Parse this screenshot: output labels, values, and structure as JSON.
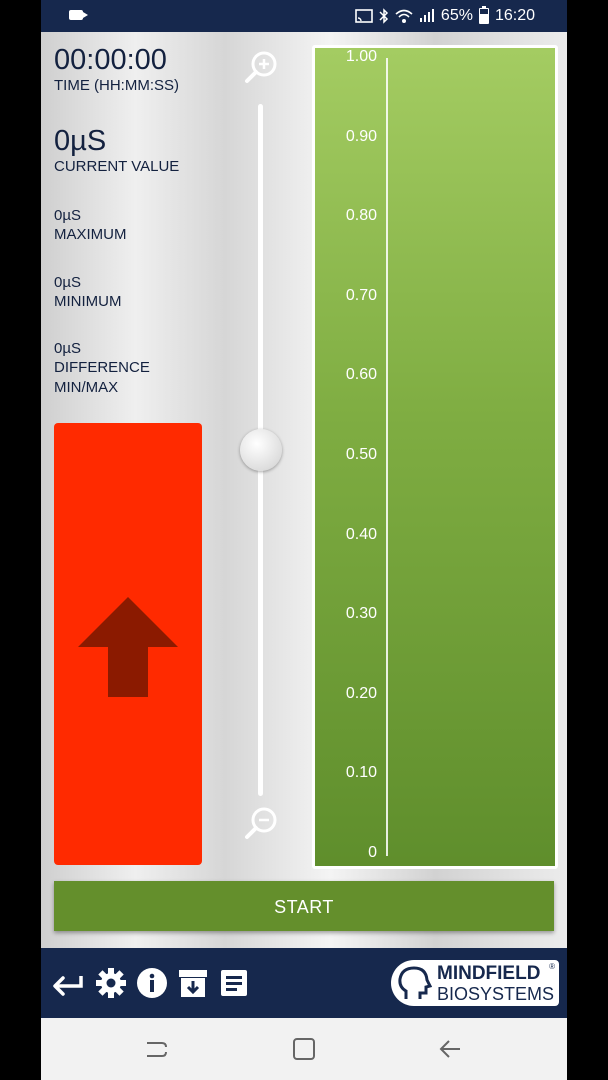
{
  "status_bar": {
    "battery_percent": "65%",
    "time": "16:20",
    "battery_level": 0.65,
    "icons": [
      "video-icon",
      "cast-icon",
      "bluetooth-icon",
      "wifi-icon",
      "signal-icon",
      "battery-icon"
    ]
  },
  "stats": {
    "time_value": "00:00:00",
    "time_label": "TIME (HH:MM:SS)",
    "current_value": "0µS",
    "current_label": "CURRENT VALUE",
    "maximum_value": "0µS",
    "maximum_label": "MAXIMUM",
    "minimum_value": "0µS",
    "minimum_label": "MINIMUM",
    "difference_value": "0µS",
    "difference_label_line1": "DIFFERENCE",
    "difference_label_line2": "MIN/MAX"
  },
  "indicator": {
    "color": "#ff2a00",
    "arrow_color": "#8b1a00",
    "direction": "up"
  },
  "zoom_slider": {
    "level": 0.5,
    "zoom_in_icon": "zoom-in-icon",
    "zoom_out_icon": "zoom-out-icon"
  },
  "gauge": {
    "ticks": [
      "1.00",
      "0.90",
      "0.80",
      "0.70",
      "0.60",
      "0.50",
      "0.40",
      "0.30",
      "0.20",
      "0.10",
      "0"
    ],
    "colors": {
      "top": "#a4cc62",
      "bottom": "#5f8e2c"
    }
  },
  "start_button": {
    "label": "START",
    "color": "#648f2c"
  },
  "toolbar": {
    "icons": [
      "back-arrow-icon",
      "settings-gear-icon",
      "info-icon",
      "archive-icon",
      "notes-icon"
    ],
    "logo_line1": "MINDFIELD",
    "logo_line2": "BIOSYSTEMS",
    "logo_reg": "®"
  },
  "nav_bar": {
    "buttons": [
      "recent-apps-icon",
      "home-icon",
      "back-icon"
    ]
  },
  "colors": {
    "navy": "#16284d",
    "red": "#ff2a00",
    "green": "#648f2c"
  }
}
